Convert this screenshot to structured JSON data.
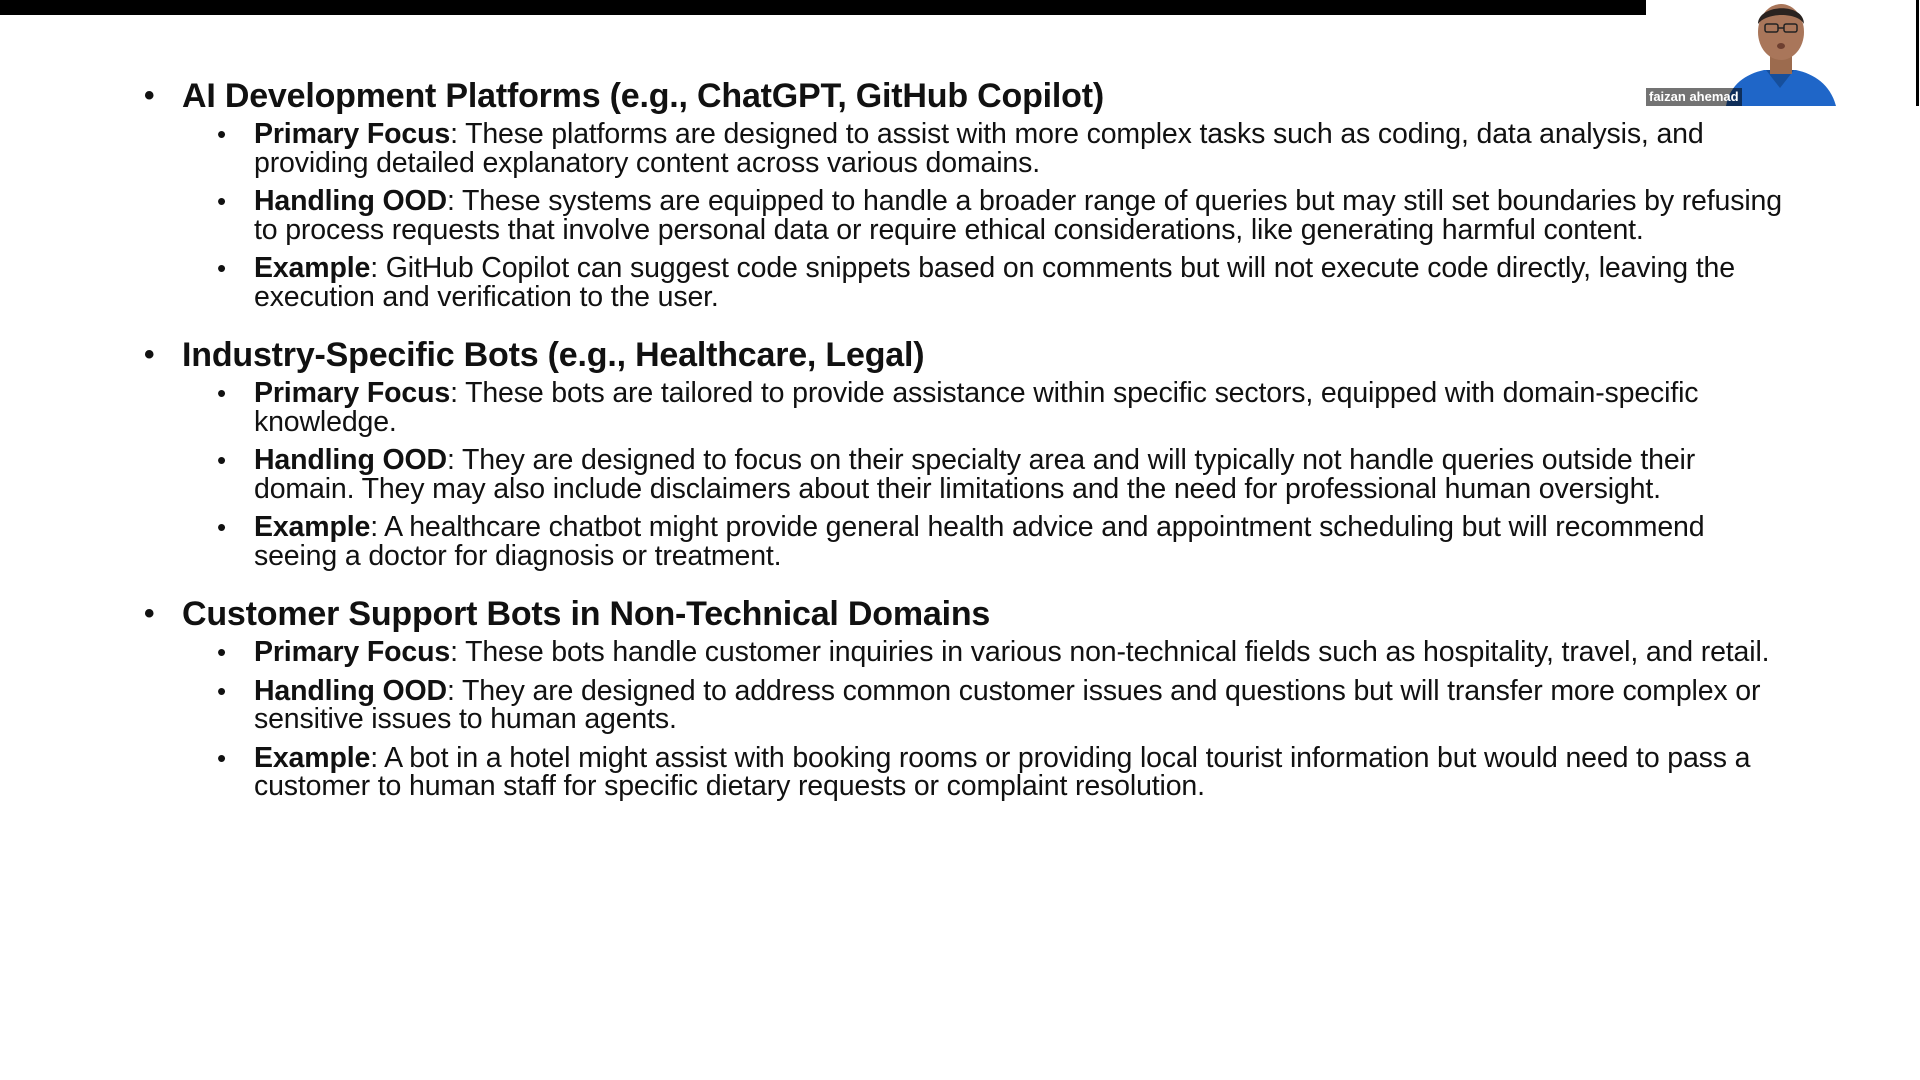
{
  "video": {
    "participant_name": "faizan ahemad"
  },
  "sections": [
    {
      "heading": "AI Development Platforms (e.g., ChatGPT, GitHub Copilot)",
      "items": [
        {
          "label": "Primary Focus",
          "text": ": These platforms are designed to assist with more complex tasks such as coding, data analysis, and providing detailed explanatory content across various domains."
        },
        {
          "label": "Handling OOD",
          "text": ": These systems are equipped to handle a broader range of queries but may still set boundaries by refusing to process requests that involve personal data or require ethical considerations, like generating harmful content."
        },
        {
          "label": "Example",
          "text": ": GitHub Copilot can suggest code snippets based on comments but will not execute code directly, leaving the execution and verification to the user."
        }
      ]
    },
    {
      "heading": "Industry-Specific Bots (e.g., Healthcare, Legal)",
      "items": [
        {
          "label": "Primary Focus",
          "text": ": These bots are tailored to provide assistance within specific sectors, equipped with domain-specific knowledge."
        },
        {
          "label": "Handling OOD",
          "text": ": They are designed to focus on their specialty area and will typically not handle queries outside their domain. They may also include disclaimers about their limitations and the need for professional human oversight."
        },
        {
          "label": "Example",
          "text": ": A healthcare chatbot might provide general health advice and appointment scheduling but will recommend seeing a doctor for diagnosis or treatment."
        }
      ]
    },
    {
      "heading": "Customer Support Bots in Non-Technical Domains",
      "items": [
        {
          "label": "Primary Focus",
          "text": ": These bots handle customer inquiries in various non-technical fields such as hospitality, travel, and retail."
        },
        {
          "label": "Handling OOD",
          "text": ": They are designed to address common customer issues and questions but will transfer more complex or sensitive issues to human agents."
        },
        {
          "label": "Example",
          "text": ": A bot in a hotel might assist with booking rooms or providing local tourist information but would need to pass a customer to human staff for specific dietary requests or complaint resolution."
        }
      ]
    }
  ]
}
